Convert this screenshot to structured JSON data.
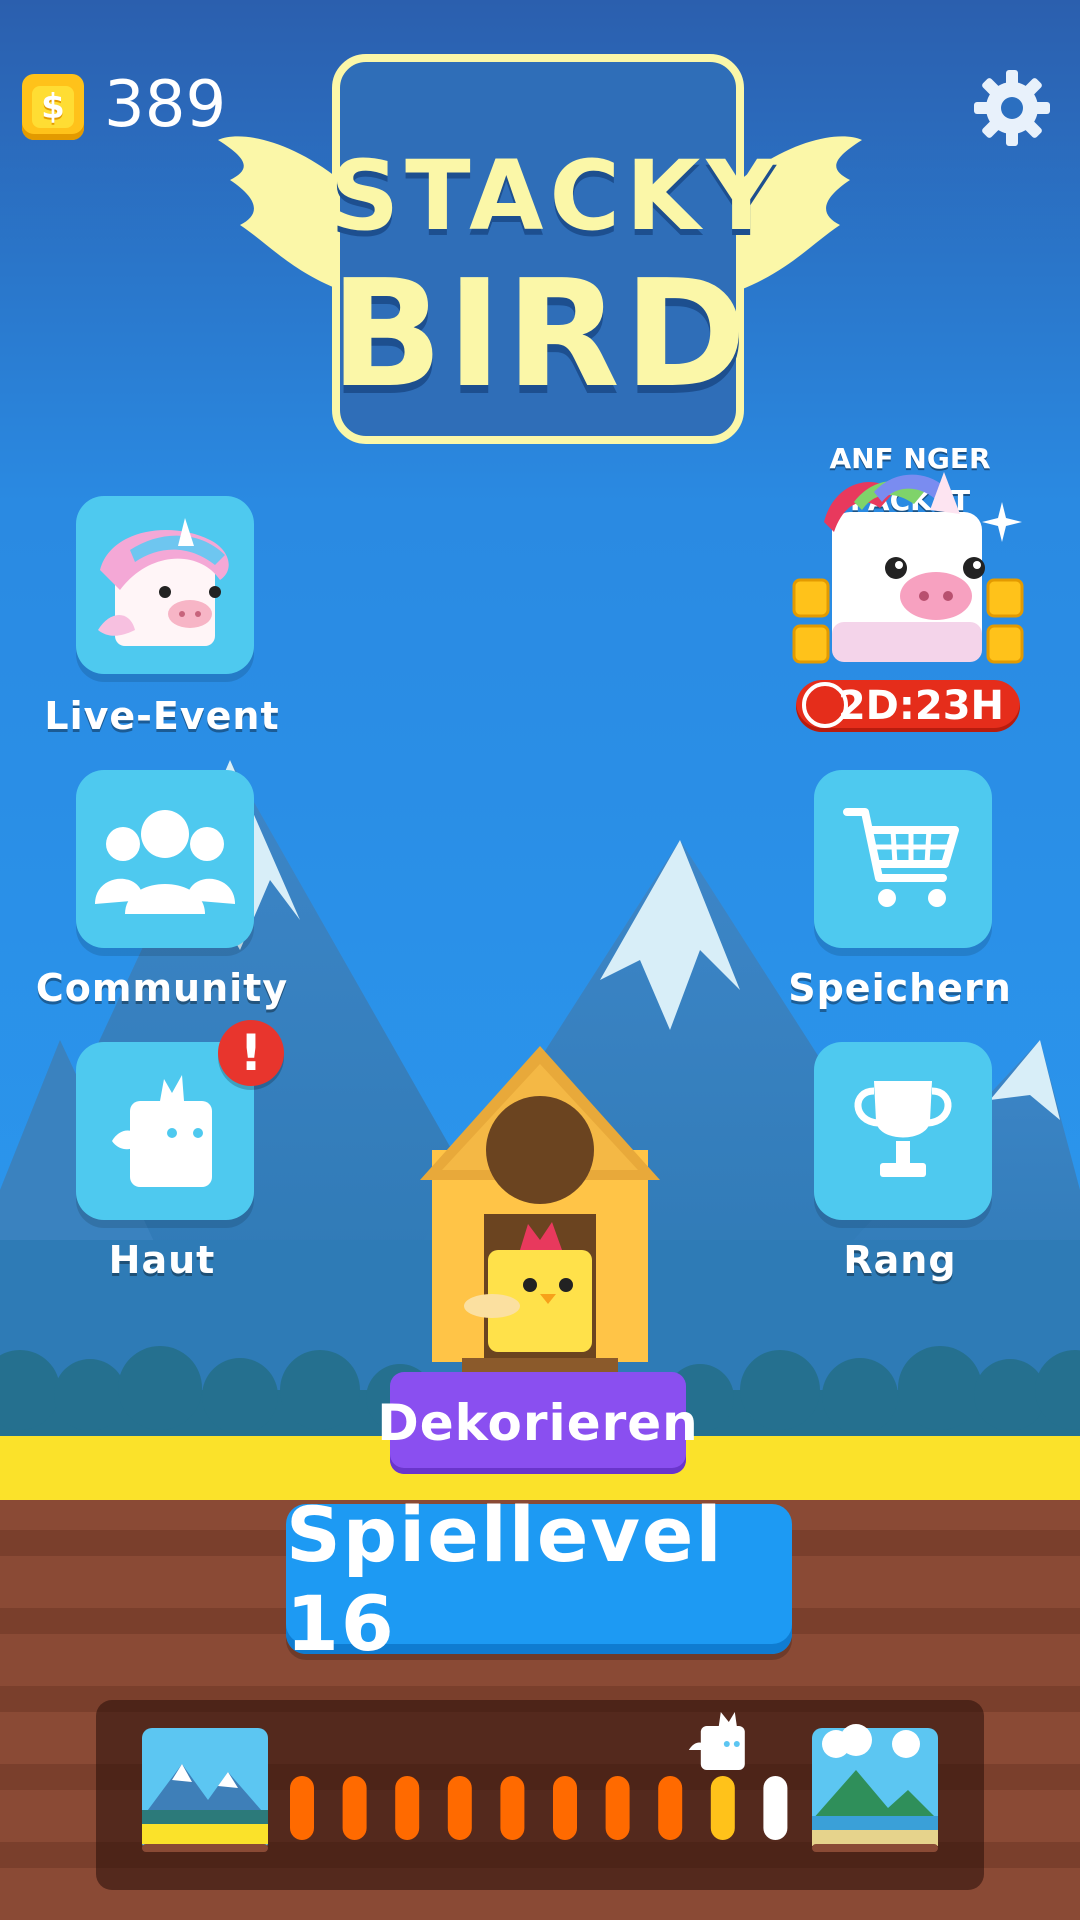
{
  "header": {
    "coin_icon": "dollar-coin-icon",
    "coin_symbol": "$",
    "coin_count": "389",
    "settings_icon": "gear-icon"
  },
  "logo": {
    "line1": "STACKY",
    "line2": "BIRD"
  },
  "left_menu": [
    {
      "label": "Live-Event",
      "icon": "unicorn-pig-icon"
    },
    {
      "label": "Community",
      "icon": "people-group-icon"
    },
    {
      "label": "Haut",
      "icon": "bird-silhouette-icon",
      "alert": "!"
    }
  ],
  "right_menu": {
    "starter_pack": {
      "title_line1": "ANF NGER",
      "title_line2": "PACKET",
      "timer": "2D:23H",
      "icon": "unicorn-pig-icon"
    },
    "items": [
      {
        "label": "Speichern",
        "icon": "shopping-cart-icon"
      },
      {
        "label": "Rang",
        "icon": "trophy-icon"
      }
    ]
  },
  "decorate_button": "Dekorieren",
  "play_button": "Spiellevel 16",
  "progress": {
    "total_pips": 10,
    "completed_pips": 8,
    "current_pip": 9,
    "colors": {
      "completed": "#ff6a00",
      "current": "#ffc21a",
      "upcoming": "#ffffff"
    },
    "start_icon": "mountain-world-icon",
    "end_icon": "island-world-icon",
    "marker_icon": "bird-marker-icon"
  }
}
